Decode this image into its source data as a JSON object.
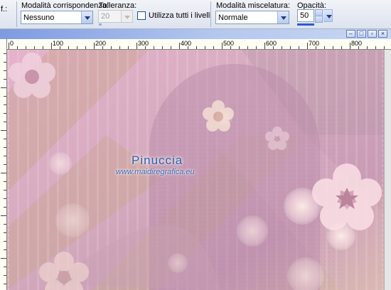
{
  "toolbar": {
    "cut_label": "f.:",
    "match_mode_label": "Modalità corrispondenza:",
    "match_mode_value": "Nessuno",
    "tolerance_label": "Tolleranza:",
    "tolerance_value": "20",
    "all_layers_label": "Utilizza tutti i livelli",
    "blend_mode_label": "Modalità miscelatura:",
    "blend_mode_value": "Normale",
    "opacity_label": "Opacità:",
    "opacity_value": "50"
  },
  "ruler": {
    "labels": [
      "0",
      "100",
      "200",
      "300",
      "400",
      "500",
      "600",
      "700",
      "800"
    ]
  },
  "watermark": {
    "name": "Pinuccia",
    "url": "www.maidiregrafica.eu"
  },
  "colors": {
    "toolbar_bg": "#e7ebf3",
    "title_bar": "#7d9be0",
    "canvas_pink": "#d9a6c6",
    "canvas_beige": "#d2b79a",
    "canvas_mauve": "#b68aa6",
    "watermark": "#2e5fa6"
  }
}
